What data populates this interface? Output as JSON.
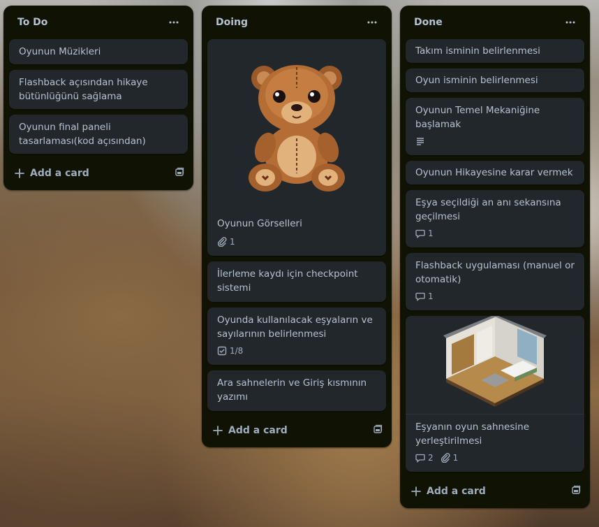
{
  "lists": [
    {
      "title": "To Do",
      "cards": [
        {
          "title": "Oyunun Müzikleri"
        },
        {
          "title": "Flashback açısından hikaye bütünlüğünü sağlama"
        },
        {
          "title": "Oyunun final paneli tasarlaması(kod açısından)"
        }
      ],
      "add_label": "Add a card"
    },
    {
      "title": "Doing",
      "cards": [
        {
          "title": "Oyunun Görselleri",
          "attachments": "1"
        },
        {
          "title": "İlerleme kaydı için checkpoint sistemi"
        },
        {
          "title": "Oyunda kullanılacak eşyaların ve sayılarının belirlenmesi",
          "checklist": "1/8"
        },
        {
          "title": "Ara sahnelerin ve Giriş kısmının yazımı"
        }
      ],
      "add_label": "Add a card"
    },
    {
      "title": "Done",
      "cards": [
        {
          "title": "Takım isminin belirlenmesi"
        },
        {
          "title": "Oyun isminin belirlenmesi"
        },
        {
          "title": "Oyunun Temel Mekaniğine başlamak"
        },
        {
          "title": "Oyunun Hikayesine karar vermek"
        },
        {
          "title": "Eşya seçildiği an anı sekansına geçilmesi",
          "comments": "1"
        },
        {
          "title": "Flashback uygulaması (manuel or otomatik)",
          "comments": "1"
        },
        {
          "title": "Eşyanın oyun sahnesine yerleştirilmesi",
          "comments": "2",
          "attachments": "1"
        }
      ],
      "add_label": "Add a card"
    }
  ],
  "icons": {
    "menu": "ellipsis-icon",
    "add": "plus-icon",
    "template": "card-template-icon",
    "description": "description-icon",
    "attachment": "paperclip-icon",
    "comment": "comment-icon",
    "checklist": "checklist-icon"
  },
  "colors": {
    "list_bg": "#101204",
    "card_bg": "#22272b",
    "text": "#b6c2cf",
    "muted": "#9fadbc"
  }
}
